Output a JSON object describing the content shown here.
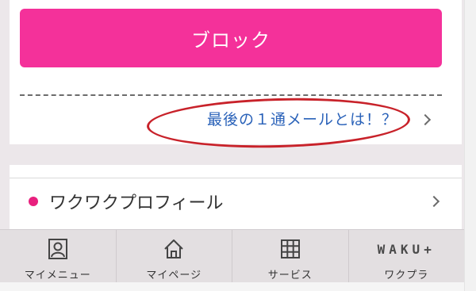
{
  "block_button": {
    "label": "ブロック"
  },
  "last_mail": {
    "link_text": "最後の１通メールとは！？"
  },
  "profile": {
    "label": "ワクワクプロフィール"
  },
  "bottom_nav": {
    "items": [
      {
        "label": "マイメニュー",
        "icon": "person-frame-icon"
      },
      {
        "label": "マイページ",
        "icon": "home-icon"
      },
      {
        "label": "サービス",
        "icon": "grid-icon"
      },
      {
        "label": "ワクプラ",
        "icon": "waku-plus-logo",
        "logo_text": "WAKU+"
      }
    ]
  },
  "colors": {
    "accent_pink": "#f4319a",
    "link_blue": "#2a62b9",
    "annotation_red": "#c8222a",
    "dot_pink": "#e8207e"
  }
}
